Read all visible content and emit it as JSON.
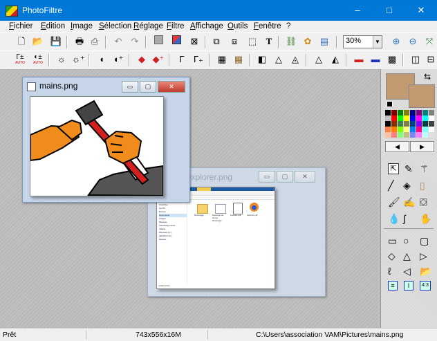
{
  "app": {
    "title": "PhotoFiltre"
  },
  "window_controls": {
    "minimize": "–",
    "maximize": "□",
    "close": "✕"
  },
  "menu": [
    "Fichier",
    "Edition",
    "Image",
    "Sélection",
    "Réglage",
    "Filtre",
    "Affichage",
    "Outils",
    "Fenêtre",
    "?"
  ],
  "toolbar": {
    "zoom": "30%",
    "auto_label_1": "AUTO",
    "auto_label_2": "AUTO"
  },
  "documents": [
    {
      "title": "mains.png",
      "active": true
    },
    {
      "title": "explorer.png",
      "active": false
    }
  ],
  "explorer_thumb": {
    "tabs": [
      "Fichier",
      "Accueil",
      "Partage",
      "Affichage",
      "Gestion"
    ],
    "sidebar": [
      "Accès rapide",
      "OneDrive",
      "Ce PC",
      "Bureau",
      "Documents",
      "Images",
      "Musique",
      "Téléchargements",
      "Vidéos",
      "Windows (C:)",
      "LENOVO (D:)",
      "Réseau"
    ],
    "files": [
      "Rectangle",
      "Message de Group Rectangle",
      "Fenêtre.pdf",
      "Fenêtre.pdf"
    ],
    "status": "4 élément(s)"
  },
  "colors": {
    "primary": "#c29a72",
    "secondary": "#c29a72",
    "palette": [
      "#000000",
      "#800000",
      "#008000",
      "#808000",
      "#000080",
      "#800080",
      "#008080",
      "#808080",
      "#c0c0c0",
      "#ff0000",
      "#00ff00",
      "#ffff00",
      "#0000ff",
      "#ff00ff",
      "#00ffff",
      "#ffffff",
      "#000000",
      "#803000",
      "#408040",
      "#808040",
      "#004080",
      "#8000ff",
      "#004040",
      "#404040",
      "#ff8040",
      "#ff8000",
      "#80ff00",
      "#ffff80",
      "#0080ff",
      "#ff0080",
      "#80ffff",
      "#ffffff",
      "#ffc0a0",
      "#ff8080",
      "#80ff80",
      "#c0c080",
      "#8080ff",
      "#ff80ff",
      "#c0ffff",
      "#e0e0e0"
    ]
  },
  "status": {
    "state": "Prêt",
    "dimensions": "743x556x16M",
    "path": "C:\\Users\\association VAM\\Pictures\\mains.png"
  }
}
